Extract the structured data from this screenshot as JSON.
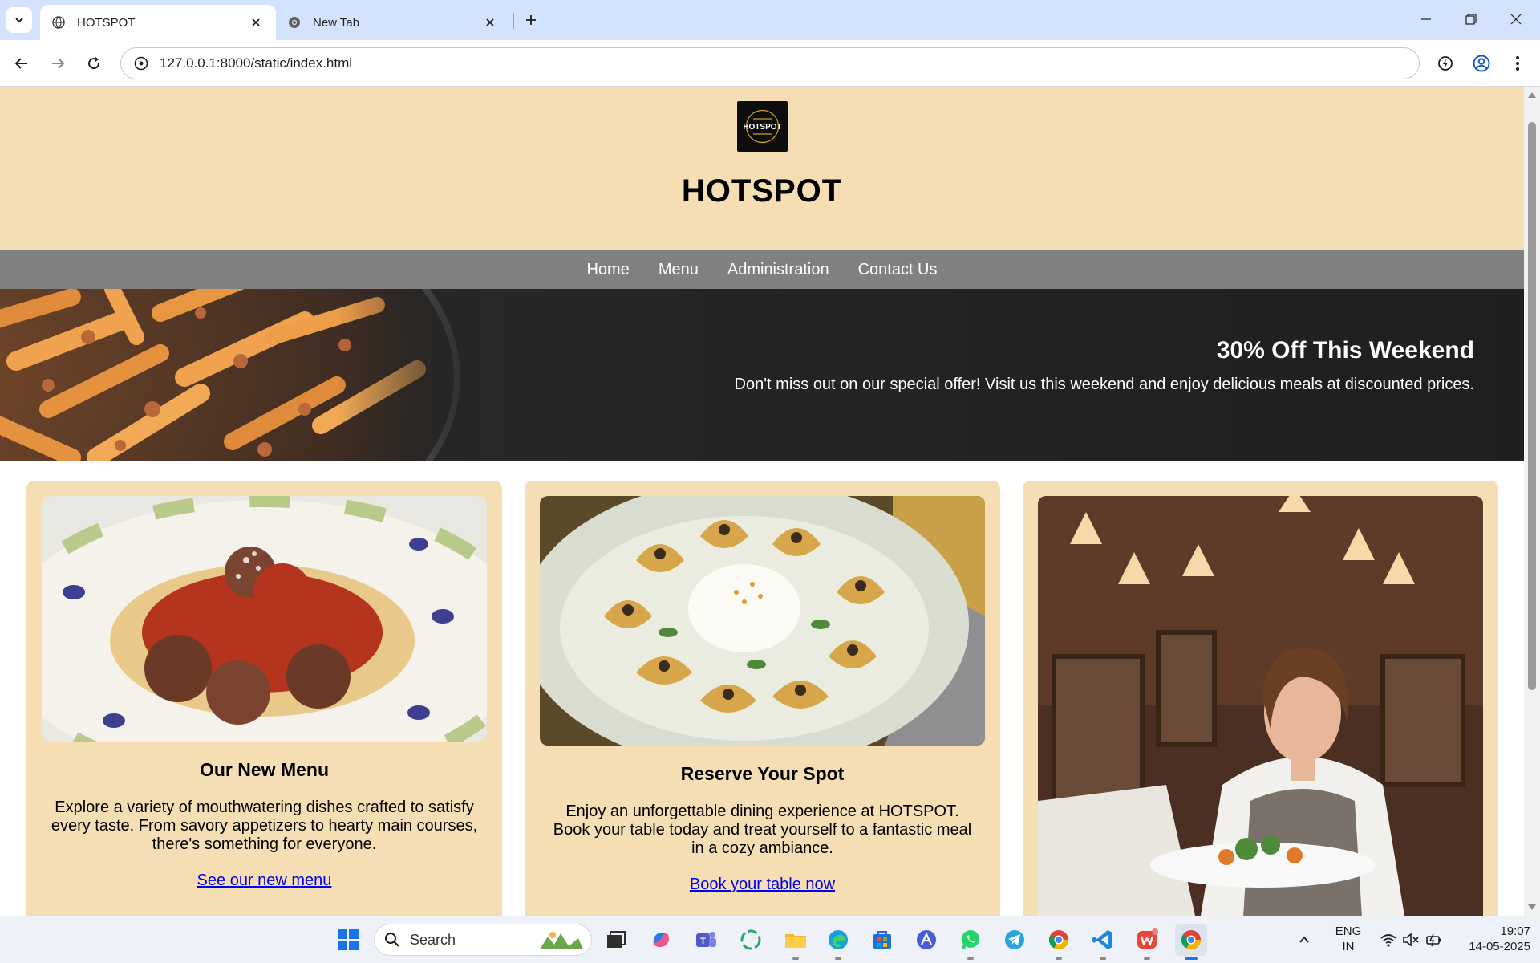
{
  "browser": {
    "tabs": [
      {
        "title": "HOTSPOT",
        "active": true
      },
      {
        "title": "New Tab",
        "active": false
      }
    ],
    "url": "127.0.0.1:8000/static/index.html"
  },
  "site": {
    "logo_text": "HOTSPOT",
    "title": "HOTSPOT",
    "nav": [
      "Home",
      "Menu",
      "Administration",
      "Contact Us"
    ],
    "banner": {
      "title": "30% Off This Weekend",
      "subtitle": "Don't miss out on our special offer! Visit us this weekend and enjoy delicious meals at discounted prices."
    },
    "cards": [
      {
        "title": "Our New Menu",
        "text": "Explore a variety of mouthwatering dishes crafted to satisfy every taste. From savory appetizers to hearty main courses, there's something for everyone.",
        "link": "See our new menu"
      },
      {
        "title": "Reserve Your Spot",
        "text": "Enjoy an unforgettable dining experience at HOTSPOT. Book your table today and treat yourself to a fantastic meal in a cozy ambiance.",
        "link": "Book your table now"
      },
      {
        "title": "",
        "text": "",
        "link": ""
      }
    ]
  },
  "taskbar": {
    "search_placeholder": "Search",
    "language": "ENG",
    "region": "IN",
    "time": "19:07",
    "date": "14-05-2025"
  },
  "colors": {
    "header_bg": "#f5deb3",
    "nav_bg": "#808080",
    "banner_bg": "#262626",
    "link": "#0000ee",
    "tabbar_bg": "#d3e3fd"
  }
}
